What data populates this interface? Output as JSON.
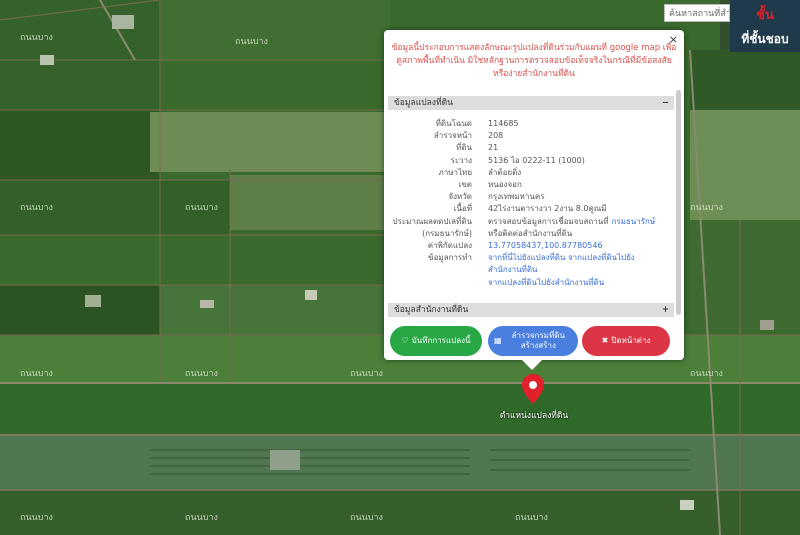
{
  "search": {
    "placeholder": "ค้นหาสถานที่สำ"
  },
  "topright": {
    "red_text": "ชั้น",
    "white_text": "ที่ชั้นชอบ"
  },
  "map_labels": [
    "ถนนบาง",
    "ถนนบาง",
    "ถนนบาง",
    "ถนนบาง",
    "ถนนบาง",
    "ถนนบาง",
    "ถนนบาง",
    "ถนนบาง",
    "ถนนบาง",
    "ถนนบาง",
    "ถนนบาง",
    "ถนนบาง",
    "ถนนบาง"
  ],
  "popup": {
    "close_label": "×",
    "notice": "ข้อมูลนี้ประกอบการแสดงลักษณะรูปแปลงที่ดินร่วมกับแผนที่ google map เพื่อดูสภาพพื้นที่ทำเนิน มิใช่หลักฐานการตรวจสอบข้อเท็จจริงในกรณีที่มีข้อสงสัยหรือง่ายสำนักงานที่ดิน",
    "section1_title": "ข้อมูลแปลงที่ดิน",
    "section1_toggle": "−",
    "rows": [
      {
        "key": "ที่ดินโฉนด",
        "value": "114685"
      },
      {
        "key": "ลำรวจหน้า",
        "value": "208"
      },
      {
        "key": "ที่ดิน",
        "value": "21"
      },
      {
        "key": "ระวาง",
        "value": "5136 ไอ 0222-11 (1000)"
      },
      {
        "key": "ภาษาไทย",
        "value": "ลำต้อยติ่ง"
      },
      {
        "key": "เขต",
        "value": "หนองจอก"
      },
      {
        "key": "จังหวัด",
        "value": "กรุงเทพมหานคร"
      },
      {
        "key": "เนื้อที่",
        "value": "42ไร่งานตารางวา 2งาน 8.0คูณมี"
      },
      {
        "key": "ประมาณผลตดปเลที่ดิน",
        "value": "ตรวจสอบข้อมูลการเชื่อมจบสถานที่",
        "value_link": "กรมธนารักษ์"
      },
      {
        "key": "(กรมธนารักษ์)",
        "value": "หรือติดต่อสำนักงานที่ดิน"
      },
      {
        "key": "ค่าพิกัดแปลง",
        "value": "",
        "value_link": "13.77058437,100.87780546"
      },
      {
        "key": "ข้อมูลการทำ",
        "value": "",
        "value_link": "จากที่นี่ไปยังแปลงที่ดิน จากแปลงที่ดินไปยัง"
      },
      {
        "key": "",
        "value": "",
        "value_link": "สำนักงานที่ดิน"
      },
      {
        "key": "",
        "value": "",
        "value_link": "จากแปลงที่ดินไปยังสำนักงานที่ดิน"
      }
    ],
    "section2_title": "ข้อมูลสำนักงานที่ดิน",
    "section2_toggle": "+",
    "buttons": {
      "save": "บันทึกการแปลงนี้",
      "survey": "ลำรวจกรมที่ดิน สร้างสร้าง",
      "close": "ปิดหน้าต่าง"
    },
    "colors": {
      "save": "#28a745",
      "survey": "#4a7fe0",
      "close": "#dc3545"
    }
  },
  "pin": {
    "label": "ตำแหน่งแปลงที่ดิน",
    "color": "#e0202a"
  }
}
